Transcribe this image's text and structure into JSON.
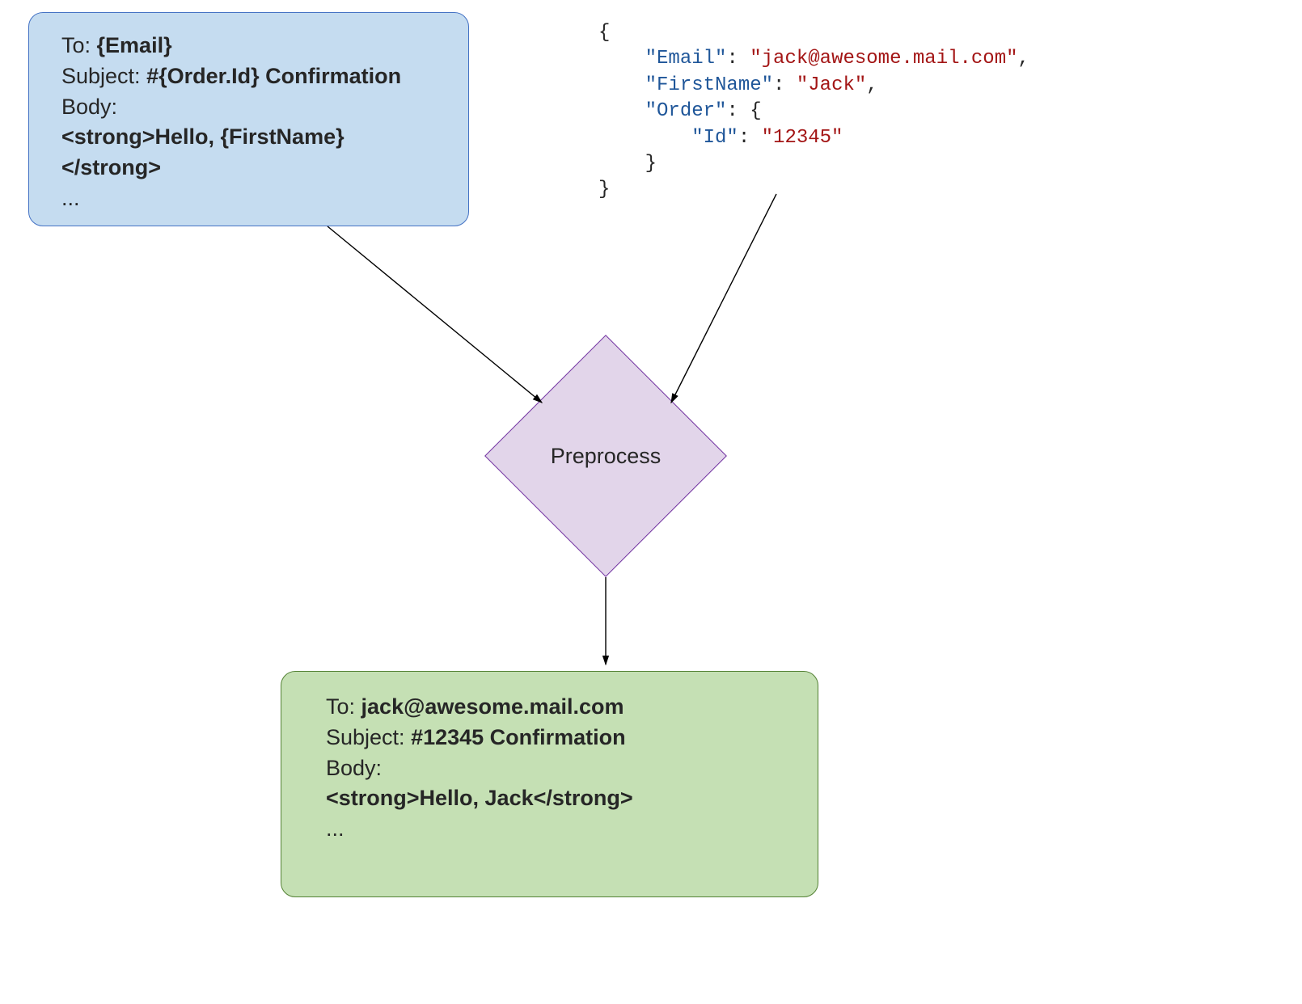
{
  "template": {
    "to_label": "To: ",
    "to_value": "{Email}",
    "subject_label": "Subject: ",
    "subject_value": "#{Order.Id} Confirmation",
    "body_label": "Body:",
    "body_line1": "<strong>Hello, {FirstName}",
    "body_line2": "</strong>",
    "ellipsis": "..."
  },
  "json": {
    "brace_open": "{",
    "email_key": "\"Email\"",
    "email_val": "\"jack@awesome.mail.com\"",
    "firstname_key": "\"FirstName\"",
    "firstname_val": "\"Jack\"",
    "order_key": "\"Order\"",
    "order_open": ": {",
    "id_key": "\"Id\"",
    "id_val": "\"12345\"",
    "inner_close": "}",
    "brace_close": "}",
    "colon": ": ",
    "comma": ","
  },
  "process": {
    "label": "Preprocess"
  },
  "output": {
    "to_label": "To: ",
    "to_value": "jack@awesome.mail.com",
    "subject_label": "Subject: ",
    "subject_value": "#12345 Confirmation",
    "body_label": "Body:",
    "body_line1": "<strong>Hello, Jack</strong>",
    "ellipsis": "..."
  }
}
